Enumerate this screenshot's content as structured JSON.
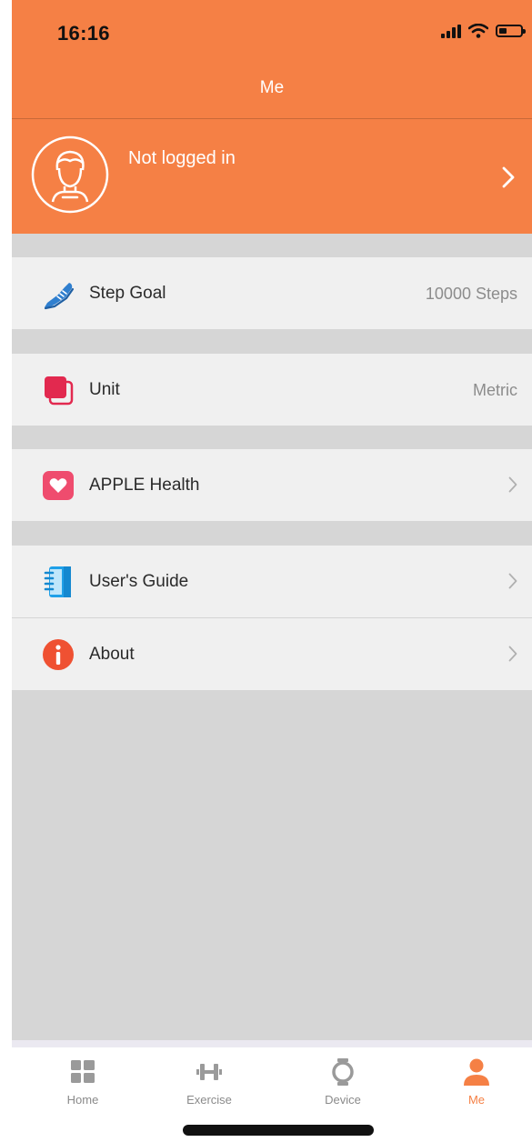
{
  "status_bar": {
    "time": "16:16"
  },
  "nav": {
    "title": "Me"
  },
  "profile": {
    "label": "Not logged in"
  },
  "settings": {
    "step_goal": {
      "label": "Step Goal",
      "value": "10000 Steps"
    },
    "unit": {
      "label": "Unit",
      "value": "Metric"
    },
    "apple_health": {
      "label": "APPLE Health"
    },
    "users_guide": {
      "label": "User's Guide"
    },
    "about": {
      "label": "About"
    }
  },
  "tabbar": {
    "home": "Home",
    "exercise": "Exercise",
    "device": "Device",
    "me": "Me"
  },
  "colors": {
    "accent": "#f58045",
    "background": "#d6d6d6",
    "row": "#f0f0f0",
    "value_text": "#8c8c8c"
  },
  "icons": {
    "profile": "avatar-icon",
    "step_goal": "sneaker-icon",
    "unit": "stacked-squares-icon",
    "apple_health": "heart-icon",
    "users_guide": "notebook-icon",
    "about": "info-icon"
  }
}
